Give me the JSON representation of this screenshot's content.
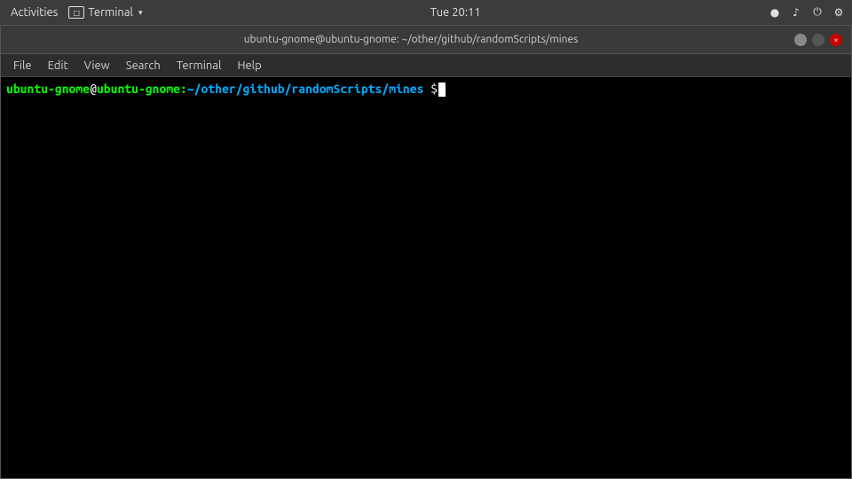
{
  "system_bar": {
    "activities": "Activities",
    "terminal_label": "Terminal",
    "datetime": "Tue 20:11"
  },
  "title_bar": {
    "title": "ubuntu-gnome@ubuntu-gnome: ~/other/github/randomScripts/mines",
    "close_btn": "×"
  },
  "menu_bar": {
    "items": [
      {
        "label": "File"
      },
      {
        "label": "Edit"
      },
      {
        "label": "View"
      },
      {
        "label": "Search"
      },
      {
        "label": "Terminal"
      },
      {
        "label": "Help"
      }
    ]
  },
  "terminal": {
    "prompt_user": "ubuntu-gnome",
    "prompt_at": "@",
    "prompt_host": "ubuntu-gnome",
    "prompt_colon": ":",
    "prompt_path": "~/other/github/randomScripts/mines",
    "prompt_dollar": "$"
  }
}
